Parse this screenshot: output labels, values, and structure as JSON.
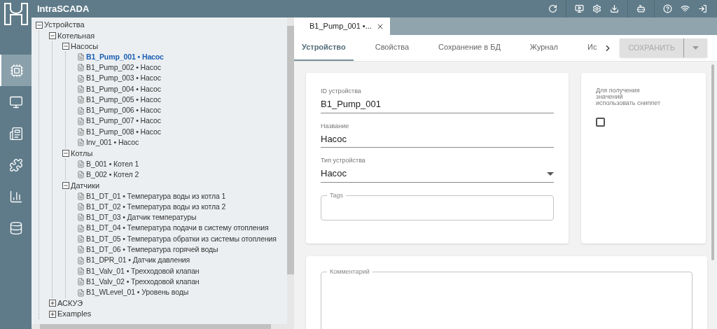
{
  "app": {
    "title": "IntraSCADA"
  },
  "rail": [
    {
      "kind": "devices",
      "selected": true
    },
    {
      "kind": "screens",
      "selected": false
    },
    {
      "kind": "reports",
      "selected": false
    },
    {
      "kind": "modules",
      "selected": false
    },
    {
      "kind": "charts",
      "selected": false
    },
    {
      "kind": "database",
      "selected": false
    }
  ],
  "tree": [
    {
      "label": "Устройства",
      "kind": "folder",
      "expanded": true,
      "children": [
        {
          "label": "Котельная",
          "kind": "folder",
          "expanded": true,
          "children": [
            {
              "label": "Насосы",
              "kind": "folder",
              "expanded": true,
              "children": [
                {
                  "label": "B1_Pump_001 • Насос",
                  "kind": "device",
                  "selected": true
                },
                {
                  "label": "B1_Pump_002 • Насос",
                  "kind": "device",
                  "selected": false
                },
                {
                  "label": "B1_Pump_003 • Насос",
                  "kind": "device",
                  "selected": false
                },
                {
                  "label": "B1_Pump_004 • Насос",
                  "kind": "device",
                  "selected": false
                },
                {
                  "label": "B1_Pump_005 • Насос",
                  "kind": "device",
                  "selected": false
                },
                {
                  "label": "B1_Pump_006 • Насос",
                  "kind": "device",
                  "selected": false
                },
                {
                  "label": "B1_Pump_007 • Насос",
                  "kind": "device",
                  "selected": false
                },
                {
                  "label": "B1_Pump_008 • Насос",
                  "kind": "device",
                  "selected": false
                },
                {
                  "label": "Inv_001 • Насос",
                  "kind": "device",
                  "selected": false
                }
              ]
            },
            {
              "label": "Котлы",
              "kind": "folder",
              "expanded": true,
              "children": [
                {
                  "label": "B_001 • Котел 1",
                  "kind": "device",
                  "selected": false
                },
                {
                  "label": "B_002 • Котел 2",
                  "kind": "device",
                  "selected": false
                }
              ]
            },
            {
              "label": "Датчики",
              "kind": "folder",
              "expanded": true,
              "children": [
                {
                  "label": "B1_DT_01 • Температура воды из котла 1",
                  "kind": "device",
                  "selected": false
                },
                {
                  "label": "B1_DT_02 • Температура воды из котла 2",
                  "kind": "device",
                  "selected": false
                },
                {
                  "label": "B1_DT_03 • Датчик температуры",
                  "kind": "device",
                  "selected": false
                },
                {
                  "label": "B1_DT_04 • Температура подачи в систему отопления",
                  "kind": "device",
                  "selected": false
                },
                {
                  "label": "B1_DT_05 • Температура обратки из системы отопления",
                  "kind": "device",
                  "selected": false
                },
                {
                  "label": "B1_DT_06 • Температура горячей воды",
                  "kind": "device",
                  "selected": false
                },
                {
                  "label": "B1_DPR_01 • Датчик давления",
                  "kind": "device",
                  "selected": false
                },
                {
                  "label": "B1_Valv_01 • Трехходовой клапан",
                  "kind": "device",
                  "selected": false
                },
                {
                  "label": "B1_Valv_02 • Трехходовой клапан",
                  "kind": "device",
                  "selected": false
                },
                {
                  "label": "B1_WLevel_01 • Уровень воды",
                  "kind": "device",
                  "selected": false
                }
              ]
            }
          ]
        },
        {
          "label": "АСКУЭ",
          "kind": "folder",
          "expanded": false
        },
        {
          "label": "Examples",
          "kind": "folder",
          "expanded": false
        }
      ]
    }
  ],
  "doc_tab": {
    "label": "B1_Pump_001 •..."
  },
  "tabs": [
    {
      "label": "Устройство",
      "selected": true
    },
    {
      "label": "Свойства",
      "selected": false
    },
    {
      "label": "Сохранение в БД",
      "selected": false
    },
    {
      "label": "Журнал",
      "selected": false
    },
    {
      "label": "Ис",
      "selected": false
    }
  ],
  "save_button": {
    "label": "СОХРАНИТЬ",
    "disabled": true
  },
  "fields": [
    {
      "kind": "text",
      "label": "ID устройства",
      "value": "B1_Pump_001"
    },
    {
      "kind": "text",
      "label": "Название",
      "value": "Насос"
    },
    {
      "kind": "select",
      "label": "Тип устройства",
      "value": "Насос"
    },
    {
      "kind": "outlined",
      "label": "Tags"
    }
  ],
  "snippet": {
    "label": "Для получения\nзначений\nиспользовать сниппет",
    "checked": false
  },
  "comment": {
    "label": "Комментарий"
  }
}
